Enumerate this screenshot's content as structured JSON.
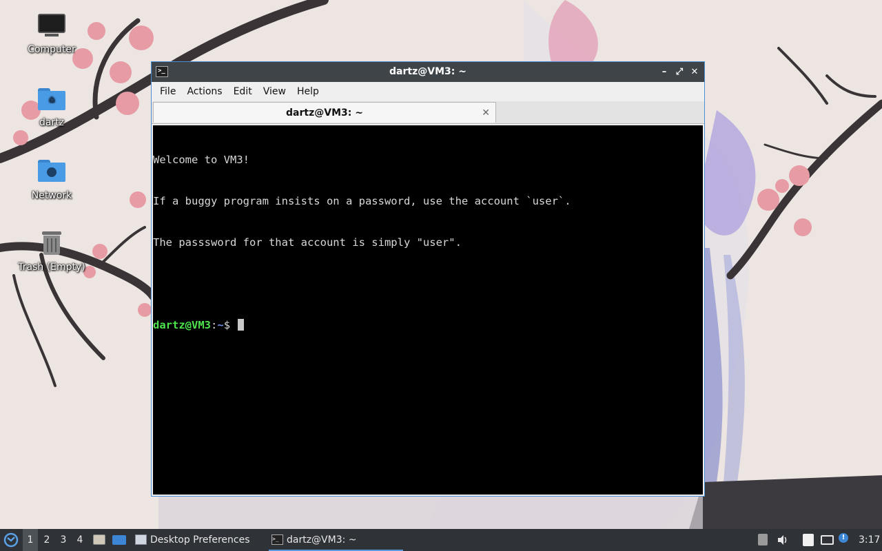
{
  "desktop": {
    "icons": [
      {
        "label": "Computer"
      },
      {
        "label": "dartz"
      },
      {
        "label": "Network"
      },
      {
        "label": "Trash (Empty)"
      }
    ]
  },
  "window": {
    "title": "dartz@VM3: ~",
    "controls": {
      "minimize": "–",
      "maximize": "⤢",
      "close": "✕"
    },
    "menu": [
      "File",
      "Actions",
      "Edit",
      "View",
      "Help"
    ],
    "tab": {
      "label": "dartz@VM3: ~",
      "close": "✕"
    },
    "terminal": {
      "lines": [
        "Welcome to VM3!",
        "If a buggy program insists on a password, use the account `user`.",
        "The passsword for that account is simply \"user\"."
      ],
      "prompt_user": "dartz@VM3",
      "prompt_sep": ":",
      "prompt_path": "~",
      "prompt_symbol": "$ "
    }
  },
  "taskbar": {
    "workspaces": [
      "1",
      "2",
      "3",
      "4"
    ],
    "active_workspace": "1",
    "tasks": [
      {
        "label": "Desktop Preferences"
      },
      {
        "label": "dartz@VM3: ~"
      }
    ],
    "clock": "3:17"
  },
  "colors": {
    "terminal_bg": "#000000",
    "prompt_user": "#4ee44e",
    "prompt_path": "#6e8fe8",
    "accent": "#4a8fd6",
    "taskbar_bg": "#2f3337"
  }
}
